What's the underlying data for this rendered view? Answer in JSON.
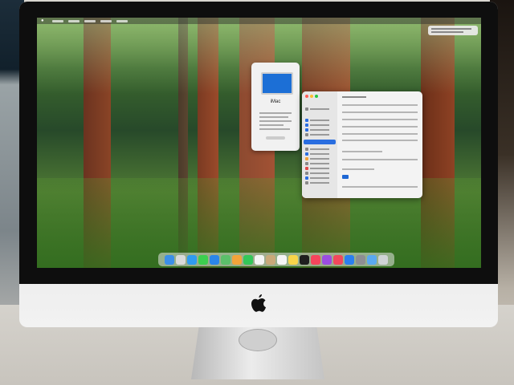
{
  "scene": {
    "device": "iMac",
    "photo_context": "store display"
  },
  "screen": {
    "menubar": {
      "items": 5
    },
    "about_window": {
      "title": "iMac"
    },
    "settings_window": {
      "selected_sidebar_index": 7
    },
    "dock": {
      "icons": [
        {
          "name": "finder-icon",
          "color": "#3b8fe8"
        },
        {
          "name": "launchpad-icon",
          "color": "#d9d9d9"
        },
        {
          "name": "safari-icon",
          "color": "#2f9bf0"
        },
        {
          "name": "messages-icon",
          "color": "#3ccf4e"
        },
        {
          "name": "mail-icon",
          "color": "#2b86e8"
        },
        {
          "name": "maps-icon",
          "color": "#5bbf6a"
        },
        {
          "name": "photos-icon",
          "color": "#f2a33a"
        },
        {
          "name": "facetime-icon",
          "color": "#34c759"
        },
        {
          "name": "calendar-icon",
          "color": "#f4f4f4"
        },
        {
          "name": "contacts-icon",
          "color": "#c9a97a"
        },
        {
          "name": "reminders-icon",
          "color": "#f5f5f5"
        },
        {
          "name": "notes-icon",
          "color": "#f7d54a"
        },
        {
          "name": "tv-icon",
          "color": "#1f1f1f"
        },
        {
          "name": "music-icon",
          "color": "#f5455c"
        },
        {
          "name": "podcasts-icon",
          "color": "#9b4de0"
        },
        {
          "name": "news-icon",
          "color": "#f2485c"
        },
        {
          "name": "app-store-icon",
          "color": "#2a7ff0"
        },
        {
          "name": "system-settings-icon",
          "color": "#8e8e93"
        },
        {
          "name": "folder-icon",
          "color": "#5aa9f0"
        },
        {
          "name": "trash-icon",
          "color": "#cfd3d6"
        }
      ]
    }
  }
}
